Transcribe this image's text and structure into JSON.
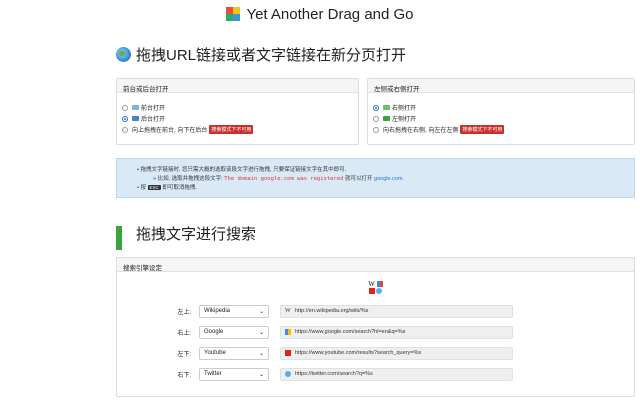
{
  "app": {
    "title": "Yet Another Drag and Go"
  },
  "section1": {
    "heading": "拖拽URL链接或者文字链接在新分页打开",
    "left_panel": {
      "title": "前台或后台打开",
      "options": [
        {
          "label": "前台打开",
          "checked": false
        },
        {
          "label": "后台打开",
          "checked": true
        },
        {
          "label": "向上拖拽在前台, 向下在后台",
          "checked": false,
          "badge": "搜索模式下不可用"
        }
      ]
    },
    "right_panel": {
      "title": "左侧或右侧打开",
      "options": [
        {
          "label": "右侧打开",
          "checked": true
        },
        {
          "label": "左侧打开",
          "checked": false
        },
        {
          "label": "向右拖拽在右侧, 向左在左侧",
          "checked": false,
          "badge": "搜索模式下不可用"
        }
      ]
    },
    "info": {
      "line1": "拖拽文字链接时, 您只需大概的选取该段文字进行拖拽, 只要保证链接文字在其中即可.",
      "line2_prefix": "» 比如, 选取并拖拽这段文字:",
      "line2_code": "The domain google.com was registered",
      "line2_mid": "就可以打开",
      "line2_link": "google.com.",
      "line3_prefix": "按",
      "line3_key": "ESC",
      "line3_suffix": "即可取消拖拽."
    }
  },
  "section2": {
    "heading": "拖拽文字进行搜索",
    "panel_title": "搜索引擎设定",
    "icon_w": "W",
    "rows": [
      {
        "label": "左上:",
        "engine": "Wikipedia",
        "url": "http://en.wikipedia.org/wiki/%s",
        "fav": "W"
      },
      {
        "label": "右上:",
        "engine": "Google",
        "url": "https://www.google.com/search?hl=en&q=%s",
        "fav": ""
      },
      {
        "label": "左下:",
        "engine": "Youtube",
        "url": "https://www.youtube.com/results?search_query=%s",
        "fav": ""
      },
      {
        "label": "右下:",
        "engine": "Twitter",
        "url": "https://twitter.com/search?q=%s",
        "fav": ""
      }
    ]
  },
  "colors": {
    "badge": "#c9302c",
    "info_bg": "#d9eaf6",
    "accent": "#2a6fd6"
  }
}
